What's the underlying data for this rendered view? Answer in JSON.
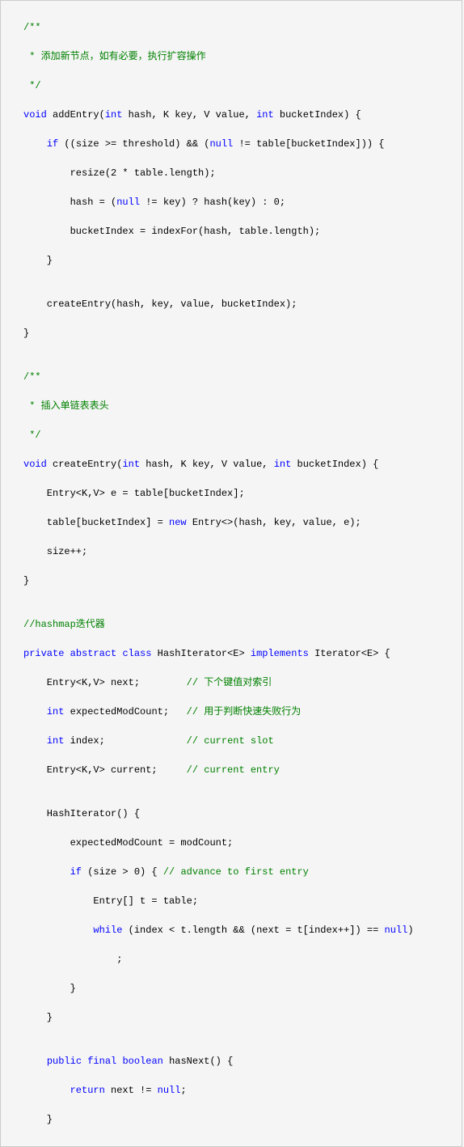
{
  "code": {
    "l1": "/**",
    "l2": " * 添加新节点，如有必要，执行扩容操作",
    "l3": " */",
    "l4_kw1": "void",
    "l4_txt1": " addEntry(",
    "l4_kw2": "int",
    "l4_txt2": " hash, K key, V value, ",
    "l4_kw3": "int",
    "l4_txt3": " bucketIndex) {",
    "l5_txt1": "    ",
    "l5_kw1": "if",
    "l5_txt2": " ((size >= threshold) && (",
    "l5_kw2": "null",
    "l5_txt3": " != table[bucketIndex])) {",
    "l6": "        resize(2 * table.length);",
    "l7_txt1": "        hash = (",
    "l7_kw1": "null",
    "l7_txt2": " != key) ? hash(key) : 0;",
    "l8": "        bucketIndex = indexFor(hash, table.length);",
    "l9": "    }",
    "l10": "",
    "l11": "    createEntry(hash, key, value, bucketIndex);",
    "l12": "}",
    "l13": "",
    "l14": "/**",
    "l15": " * 插入单链表表头",
    "l16": " */",
    "l17_kw1": "void",
    "l17_txt1": " createEntry(",
    "l17_kw2": "int",
    "l17_txt2": " hash, K key, V value, ",
    "l17_kw3": "int",
    "l17_txt3": " bucketIndex) {",
    "l18": "    Entry<K,V> e = table[bucketIndex];",
    "l19_txt1": "    table[bucketIndex] = ",
    "l19_kw1": "new",
    "l19_txt2": " Entry<>(hash, key, value, e);",
    "l20": "    size++;",
    "l21": "}",
    "l22": "",
    "l23": "//hashmap迭代器",
    "l24_kw1": "private",
    "l24_txt1": " ",
    "l24_kw2": "abstract",
    "l24_txt2": " ",
    "l24_kw3": "class",
    "l24_txt3": " HashIterator<E> ",
    "l24_kw4": "implements",
    "l24_txt4": " Iterator<E> {",
    "l25_txt1": "    Entry<K,V> next;        ",
    "l25_cmt": "// 下个键值对索引",
    "l26_txt1": "    ",
    "l26_kw1": "int",
    "l26_txt2": " expectedModCount;   ",
    "l26_cmt": "// 用于判断快速失败行为",
    "l27_txt1": "    ",
    "l27_kw1": "int",
    "l27_txt2": " index;              ",
    "l27_cmt": "// current slot",
    "l28_txt1": "    Entry<K,V> current;     ",
    "l28_cmt": "// current entry",
    "l29": "",
    "l30": "    HashIterator() {",
    "l31": "        expectedModCount = modCount;",
    "l32_txt1": "        ",
    "l32_kw1": "if",
    "l32_txt2": " (size > 0) { ",
    "l32_cmt": "// advance to first entry",
    "l33": "            Entry[] t = table;",
    "l34_txt1": "            ",
    "l34_kw1": "while",
    "l34_txt2": " (index < t.length && (next = t[index++]) == ",
    "l34_kw2": "null",
    "l34_txt3": ")",
    "l35": "                ;",
    "l36": "        }",
    "l37": "    }",
    "l38": "",
    "l39_txt1": "    ",
    "l39_kw1": "public",
    "l39_txt2": " ",
    "l39_kw2": "final",
    "l39_txt3": " ",
    "l39_kw3": "boolean",
    "l39_txt4": " hasNext() {",
    "l40_txt1": "        ",
    "l40_kw1": "return",
    "l40_txt2": " next != ",
    "l40_kw2": "null",
    "l40_txt3": ";",
    "l41": "    }"
  }
}
